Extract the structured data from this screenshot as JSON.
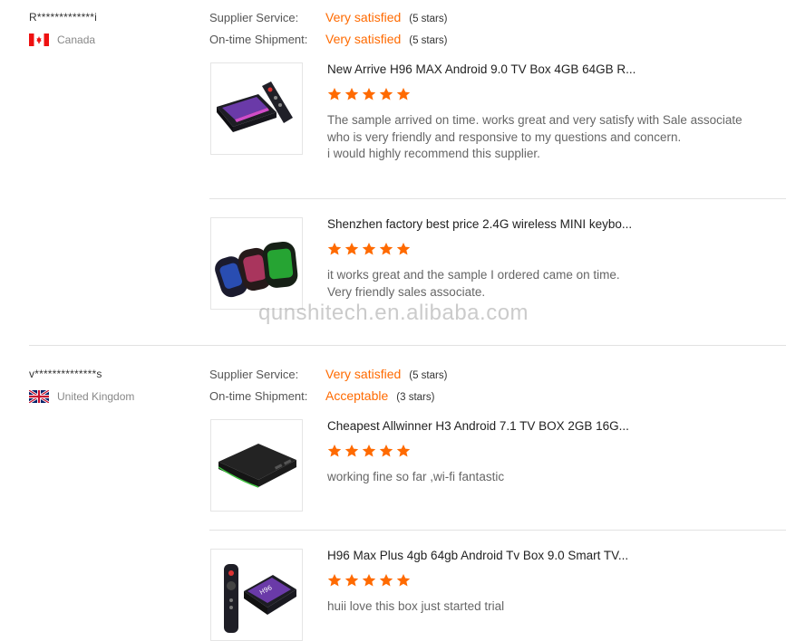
{
  "colors": {
    "accent": "#ff6a00",
    "star": "#ff6a00"
  },
  "watermark": "qunshitech.en.alibaba.com",
  "reviews": [
    {
      "reviewer": "R*************i",
      "country": "Canada",
      "supplier_service": {
        "label": "Supplier Service:",
        "value": "Very satisfied",
        "stars": "(5 stars)"
      },
      "shipment": {
        "label": "On-time Shipment:",
        "value": "Very satisfied",
        "stars": "(5 stars)"
      },
      "products": [
        {
          "title": "New Arrive H96 MAX Android 9.0 TV Box 4GB 64GB R...",
          "rating": 5,
          "comment": "The sample arrived on time.  works great and very satisfy with Sale associate\nwho is very friendly and responsive to my questions and concern.\ni would highly recommend this supplier.",
          "thumb_icon": "tv-box-icon"
        },
        {
          "title": "Shenzhen factory best price 2.4G wireless MINI keybo...",
          "rating": 5,
          "comment": "it works great and the sample I ordered came on time.\nVery friendly sales associate.",
          "thumb_icon": "mini-keyboard-icon"
        }
      ]
    },
    {
      "reviewer": "v**************s",
      "country": "United Kingdom",
      "supplier_service": {
        "label": "Supplier Service:",
        "value": "Very satisfied",
        "stars": "(5 stars)"
      },
      "shipment": {
        "label": "On-time Shipment:",
        "value": "Acceptable",
        "stars": "(3 stars)"
      },
      "products": [
        {
          "title": "Cheapest Allwinner H3 Android 7.1 TV BOX 2GB 16G...",
          "rating": 5,
          "comment": "working fine so far ,wi-fi fantastic",
          "thumb_icon": "tv-box-icon"
        },
        {
          "title": "H96 Max Plus 4gb 64gb Android Tv Box 9.0 Smart TV...",
          "rating": 5,
          "comment": "huii love this box just started trial",
          "thumb_icon": "tv-box-remote-icon"
        }
      ]
    }
  ]
}
